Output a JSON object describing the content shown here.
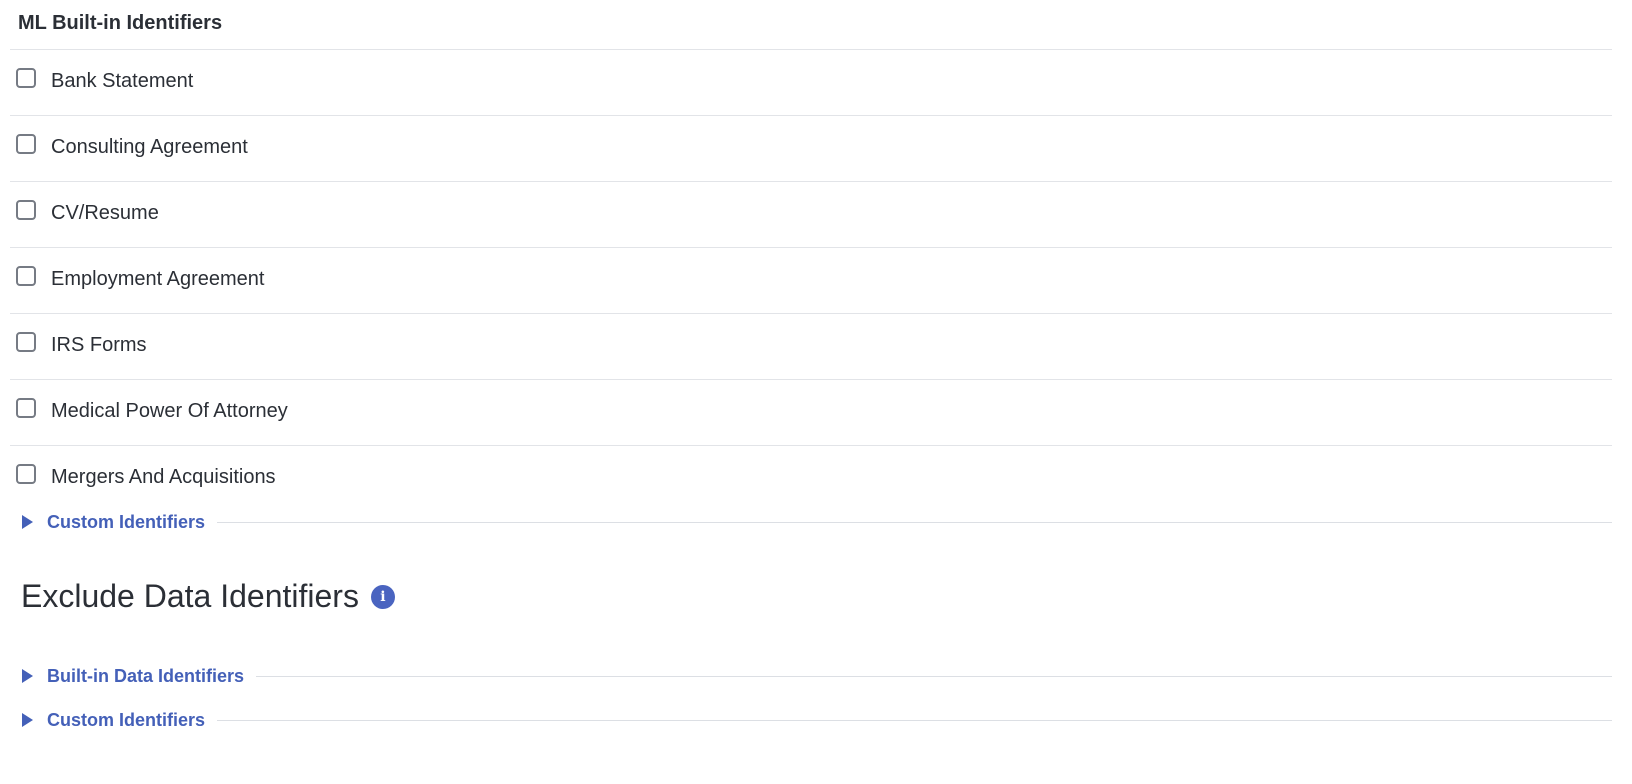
{
  "ml_section": {
    "title": "ML Built-in Identifiers",
    "items": [
      {
        "label": "Bank Statement",
        "checked": false
      },
      {
        "label": "Consulting Agreement",
        "checked": false
      },
      {
        "label": "CV/Resume",
        "checked": false
      },
      {
        "label": "Employment Agreement",
        "checked": false
      },
      {
        "label": "IRS Forms",
        "checked": false
      },
      {
        "label": "Medical Power Of Attorney",
        "checked": false
      },
      {
        "label": "Mergers And Acquisitions",
        "checked": false
      }
    ],
    "custom_expander": "Custom Identifiers"
  },
  "exclude_section": {
    "heading": "Exclude Data Identifiers",
    "info_icon": "info-icon",
    "info_glyph": "i",
    "builtin_expander": "Built-in Data Identifiers",
    "custom_expander": "Custom Identifiers"
  },
  "colors": {
    "accent": "#4460b8",
    "text": "#2b2f36",
    "divider": "#e2e4e8"
  }
}
